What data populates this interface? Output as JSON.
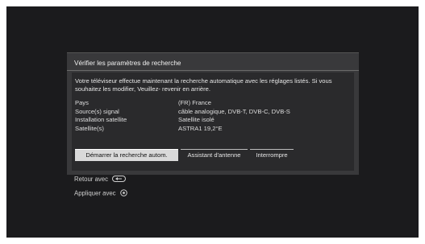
{
  "dialog": {
    "title": "Vérifier les paramètres de recherche",
    "description": "Votre téléviseur effectue maintenant la recherche automatique avec les réglages listés. Si vous souhaitez les modifier, Veuillez- revenir en arrière.",
    "settings": [
      {
        "label": "Pays",
        "value": "(FR) France"
      },
      {
        "label": "Source(s) signal",
        "value": "câble analogique, DVB-T, DVB-C, DVB-S"
      },
      {
        "label": "Installation satellite",
        "value": "Satellite isolé"
      },
      {
        "label": "Satellite(s)",
        "value": "ASTRA1 19,2°E"
      }
    ],
    "buttons": {
      "start": "Démarrer la recherche autom.",
      "antenna": "Assistant d'antenne",
      "stop": "Interrompre"
    }
  },
  "hints": {
    "back": "Retour avec",
    "back_icon": "back-key-icon",
    "apply": "Appliquer avec",
    "apply_icon": "ok-key-icon"
  },
  "colors": {
    "background": "#1b1b1d",
    "dialog": "#39393b",
    "panel": "#2a2a2c",
    "selected_button": "#d9d9d9"
  }
}
